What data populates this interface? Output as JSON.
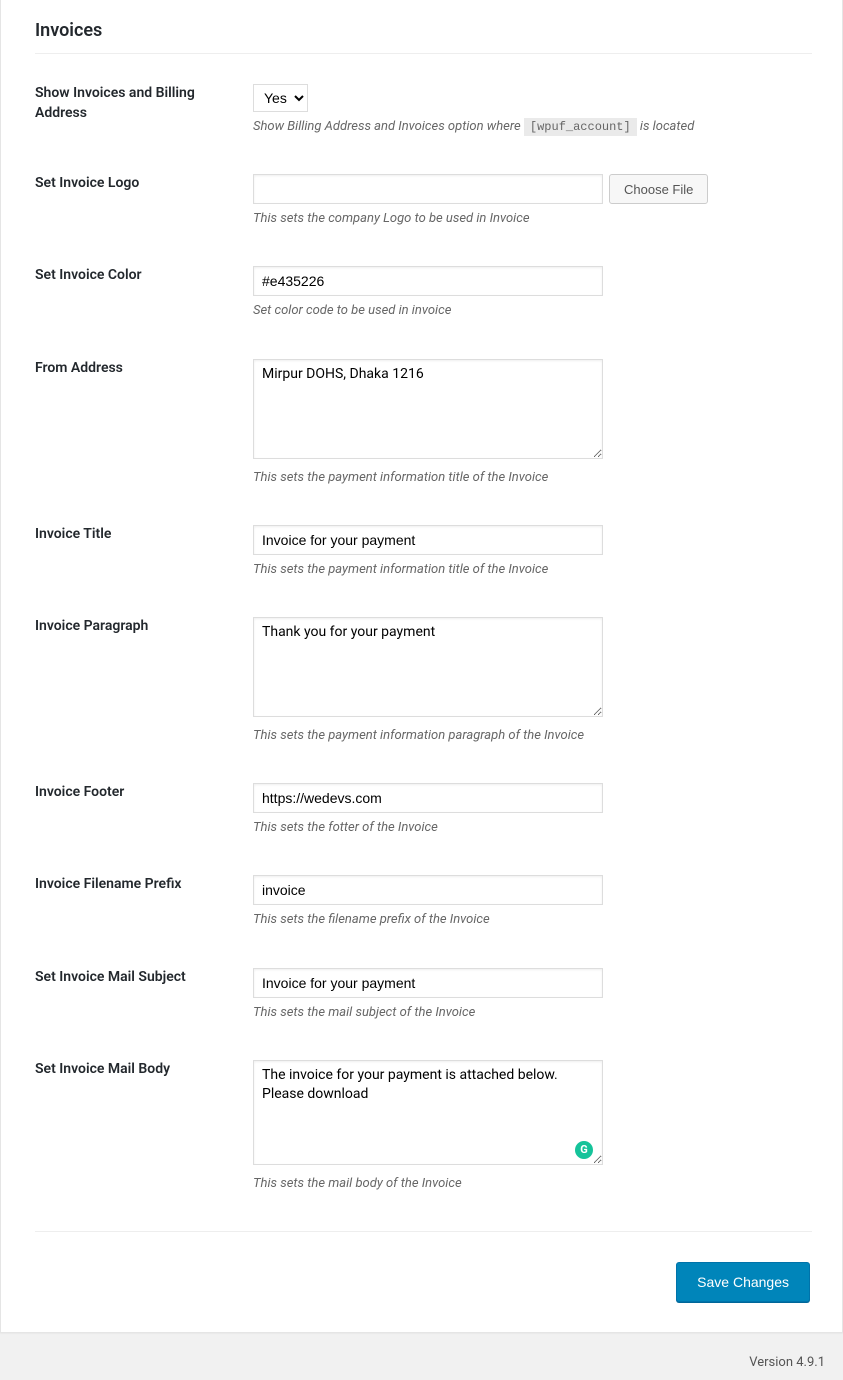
{
  "section_title": "Invoices",
  "fields": {
    "show_invoices": {
      "label": "Show Invoices and Billing Address",
      "value": "Yes",
      "desc_pre": "Show Billing Address and Invoices option where",
      "desc_code": "[wpuf_account]",
      "desc_post": " is located"
    },
    "logo": {
      "label": "Set Invoice Logo",
      "button": "Choose File",
      "desc": "This sets the company Logo to be used in Invoice"
    },
    "color": {
      "label": "Set Invoice Color",
      "value": "#e435226",
      "desc": "Set color code to be used in invoice"
    },
    "from_address": {
      "label": "From Address",
      "value": "Mirpur DOHS, Dhaka 1216",
      "desc": "This sets the payment information title of the Invoice"
    },
    "invoice_title": {
      "label": "Invoice Title",
      "value": "Invoice for your payment",
      "desc": "This sets the payment information title of the Invoice"
    },
    "invoice_paragraph": {
      "label": "Invoice Paragraph",
      "value": "Thank you for your payment",
      "desc": "This sets the payment information paragraph of the Invoice"
    },
    "invoice_footer": {
      "label": "Invoice Footer",
      "value": "https://wedevs.com",
      "desc": "This sets the fotter of the Invoice"
    },
    "filename_prefix": {
      "label": "Invoice Filename Prefix",
      "value": "invoice",
      "desc": "This sets the filename prefix of the Invoice"
    },
    "mail_subject": {
      "label": "Set Invoice Mail Subject",
      "value": "Invoice for your payment",
      "desc": "This sets the mail subject of the Invoice"
    },
    "mail_body": {
      "label": "Set Invoice Mail Body",
      "value": "The invoice for your payment is attached below. Please download",
      "desc": "This sets the mail body of the Invoice"
    }
  },
  "submit_label": "Save Changes",
  "version_label": "Version 4.9.1"
}
